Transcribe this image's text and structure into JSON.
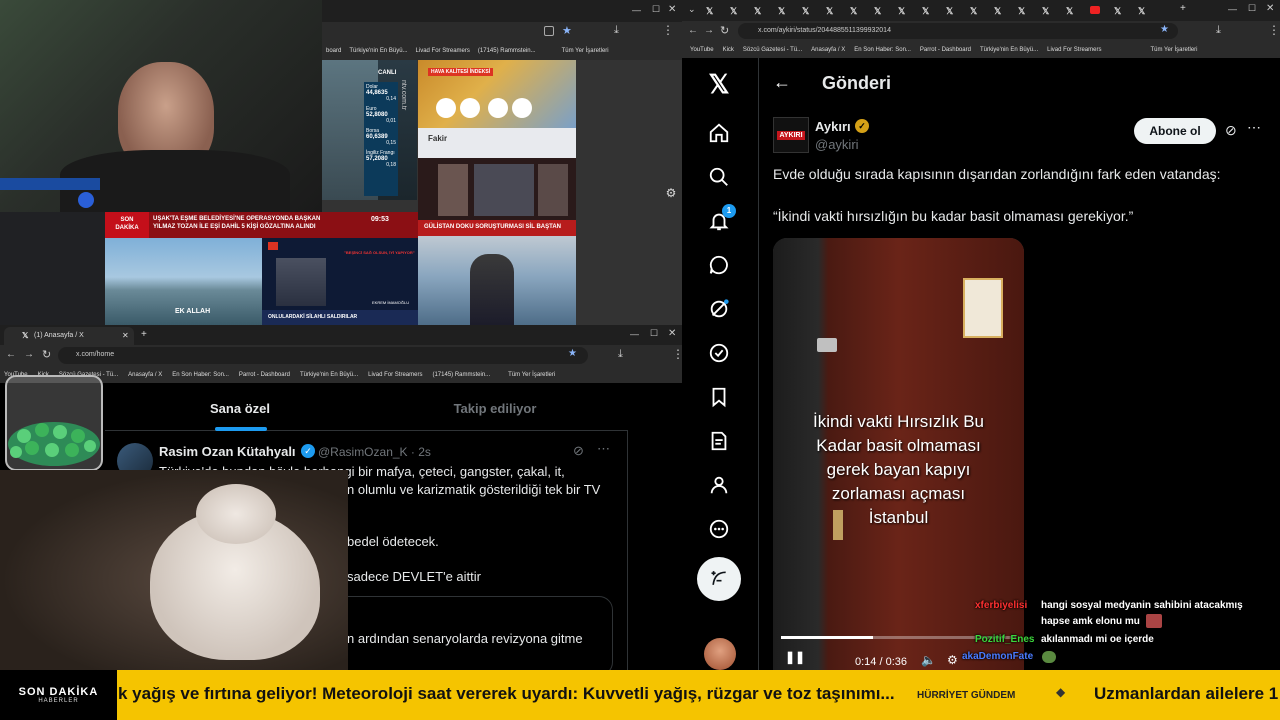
{
  "top_left_browser": {
    "bookmarks": [
      "board",
      "Türkiye'nin En Büyü...",
      "Livad For Streamers",
      "(17145) Rammstein...",
      "Tüm Yer İşaretleri"
    ],
    "tv": {
      "canli": "CANLI",
      "dolar_label": "Dolar",
      "dolar_value": "44,8635",
      "dolar_change": "0,14",
      "euro_label": "Euro",
      "euro_value": "52,8080",
      "euro_change": "0,01",
      "borsa_label": "Borsa",
      "borsa_value": "60,6389",
      "borsa_change": "0,15",
      "sterlin_label": "İngiliz Frangı",
      "sterlin_value": "57,2080",
      "sterlin_change": "0,18",
      "channel_wm": "ntv.com.tr",
      "weather_banner": "HAVA KALİTESİ İNDEKSİ",
      "fakir_logo": "Fakir",
      "son_dakika_1": "SON",
      "son_dakika_2": "DAKİKA",
      "headline": "UŞAK'TA EŞME BELEDİYESİ'NE OPERASYONDA BAŞKAN YILMAZ TOZAN İLE EŞİ DAHİL 5 KİŞİ GÖZALTINA ALINDI",
      "time": "09:53",
      "gulistan": "GÜLİSTAN DOKU SORUŞTURMASI SİL BAŞTAN",
      "onuna": "ONLULARDAKİ SİLAHLI SALDIRILAR",
      "quote_title": "\"BEŞİNCİ SAĞ OLSUN, İYİ YAPIYOR\"",
      "ekrem_label": "EKREM İMAMOĞLU",
      "bottom_text": "EK ALLAH"
    }
  },
  "bottom_left_browser": {
    "tab_title": "(1) Anasayfa / X",
    "url": "x.com/home",
    "bookmarks": [
      "YouTube",
      "Kick",
      "Sözcü Gazetesi - Tü...",
      "Anasayfa / X",
      "En Son Haber: Son...",
      "Parrot - Dashboard",
      "Türkiye'nin En Büyü...",
      "Livad For Streamers",
      "(17145) Rammstein...",
      "Tüm Yer İşaretleri"
    ],
    "tabs": {
      "for_you": "Sana özel",
      "following": "Takip ediliyor"
    },
    "tweet": {
      "name": "Rasim Ozan Kütahyalı",
      "handle": "@RasimOzan_K · 2s",
      "line1": "Türkiye'de bundan böyle herhangi bir mafya, çeteci, gangster, çakal, it,",
      "line2": "n olumlu ve karizmatik gösterildiği tek bir TV",
      "line3": "bedel ödetecek.",
      "line4": "sadece DEVLET'e aittir",
      "line5": "n ardından senaryolarda revizyona gitme"
    }
  },
  "right_browser": {
    "url": "x.com/aykiri/status/2044885511399932014",
    "bookmarks": [
      "YouTube",
      "Kick",
      "Sözcü Gazetesi - Tü...",
      "Anasayfa / X",
      "En Son Haber: Son...",
      "Parrot - Dashboard",
      "Türkiye'nin En Büyü...",
      "Livad For Streamers",
      "Tüm Yer İşaretleri"
    ],
    "header_title": "Gönderi",
    "notification_count": "1",
    "post": {
      "avatar_text": "AYKIRI",
      "author": "Aykırı",
      "handle": "@aykiri",
      "follow_button": "Abone ol",
      "text1": "Evde olduğu sırada kapısının dışarıdan zorlandığını fark eden vatandaş:",
      "text2": "“İkindi vakti hırsızlığın bu kadar basit olmaması gerekiyor.”",
      "video_caption": [
        "İkindi vakti Hırsızlık Bu",
        "Kadar basit olmaması",
        "gerek bayan kapıyı",
        "zorlaması açması",
        "İstanbul"
      ],
      "video_time": "0:14 / 0:36",
      "video_progress": 0.39
    }
  },
  "chat": [
    {
      "user": "xferbiyelisi",
      "message": "hangi sosyal medyanin sahibini atacakmış",
      "color": "#ff3030"
    },
    {
      "user": "",
      "message": "hapse amk elonu mu",
      "color": "#ff3030"
    },
    {
      "user": "Pozitif_Enes",
      "message": "akılanmadı mi oe içerde",
      "color": "#3cd63c"
    },
    {
      "user": "akaDemonFate",
      "message": "",
      "color": "#4a7bff"
    }
  ],
  "ticker": {
    "logo_line1": "SON DAKİKA",
    "logo_line2": "HABERLER",
    "text1": "k yağış ve fırtına geliyor! Meteoroloji saat vererek uyardı: Kuvvetli yağış, rüzgar ve toz taşınımı...",
    "source": "HÜRRİYET GÜNDEM",
    "text2": "Uzmanlardan ailelere 1",
    "bg_color": "#f5c400"
  }
}
